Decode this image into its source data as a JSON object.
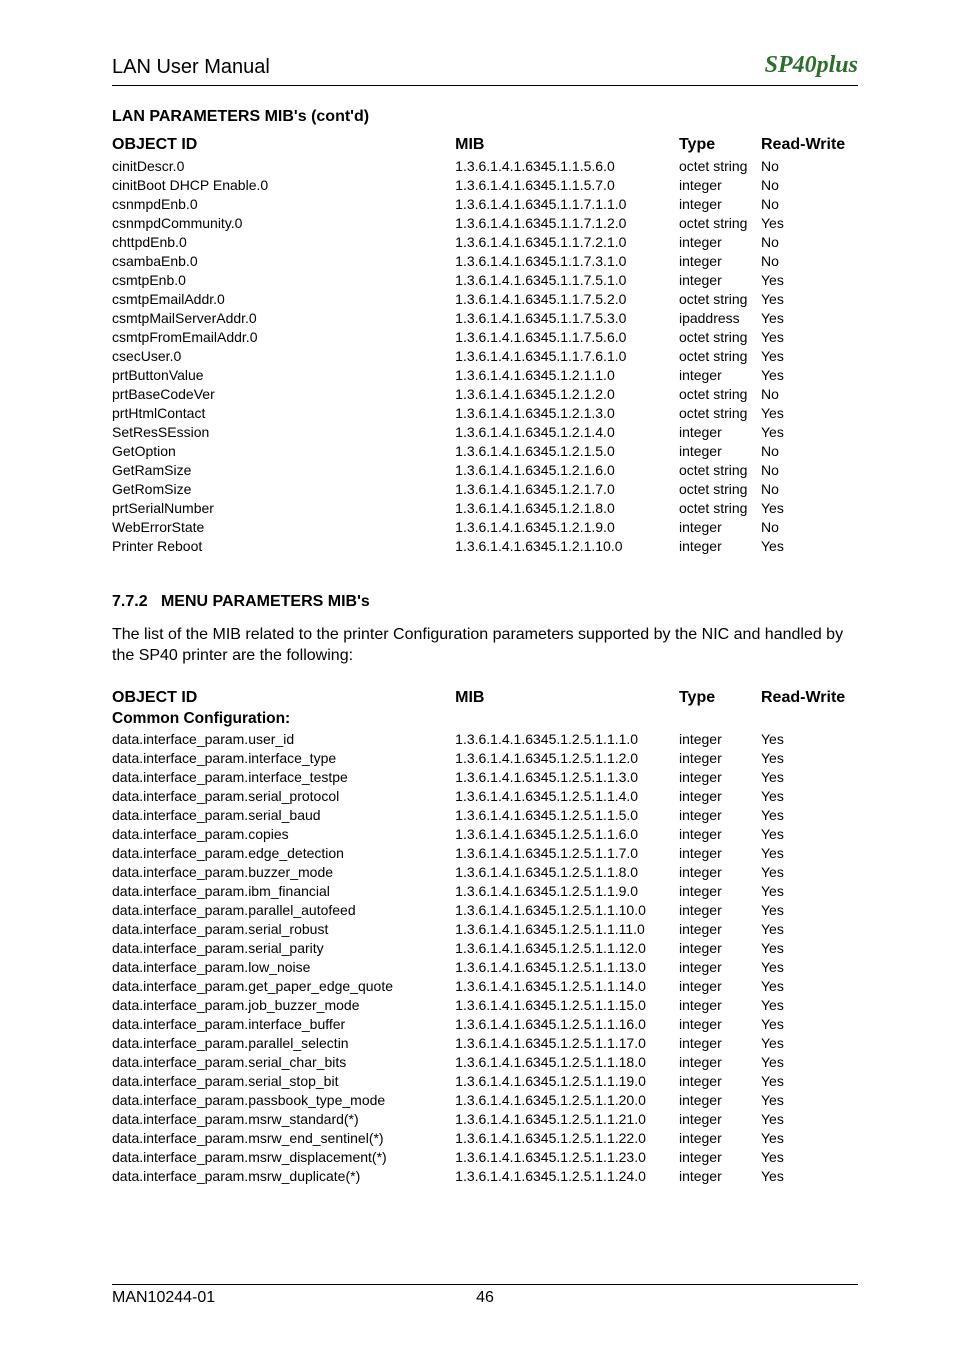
{
  "doc_title": "LAN User Manual",
  "brand_main": "SP40",
  "brand_sub": "plus",
  "section1_heading": "LAN PARAMETERS MIB's (cont'd)",
  "headers": {
    "object_id": "OBJECT ID",
    "mib": "MIB",
    "type": "Type",
    "rw": "Read-Write"
  },
  "table1": [
    {
      "obj": "cinitDescr.0",
      "mib": "1.3.6.1.4.1.6345.1.1.5.6.0",
      "type": "octet string",
      "rw": "No"
    },
    {
      "obj": "cinitBoot DHCP Enable.0",
      "mib": "1.3.6.1.4.1.6345.1.1.5.7.0",
      "type": "integer",
      "rw": "No"
    },
    {
      "obj": "csnmpdEnb.0",
      "mib": "1.3.6.1.4.1.6345.1.1.7.1.1.0",
      "type": "integer",
      "rw": "No"
    },
    {
      "obj": "csnmpdCommunity.0",
      "mib": "1.3.6.1.4.1.6345.1.1.7.1.2.0",
      "type": "octet string",
      "rw": "Yes"
    },
    {
      "obj": "chttpdEnb.0",
      "mib": "1.3.6.1.4.1.6345.1.1.7.2.1.0",
      "type": "integer",
      "rw": "No"
    },
    {
      "obj": "csambaEnb.0",
      "mib": "1.3.6.1.4.1.6345.1.1.7.3.1.0",
      "type": "integer",
      "rw": "No"
    },
    {
      "obj": "csmtpEnb.0",
      "mib": "1.3.6.1.4.1.6345.1.1.7.5.1.0",
      "type": "integer",
      "rw": "Yes"
    },
    {
      "obj": "csmtpEmailAddr.0",
      "mib": "1.3.6.1.4.1.6345.1.1.7.5.2.0",
      "type": "octet string",
      "rw": "Yes"
    },
    {
      "obj": "csmtpMailServerAddr.0",
      "mib": "1.3.6.1.4.1.6345.1.1.7.5.3.0",
      "type": "ipaddress",
      "rw": "Yes"
    },
    {
      "obj": "csmtpFromEmailAddr.0",
      "mib": "1.3.6.1.4.1.6345.1.1.7.5.6.0",
      "type": "octet string",
      "rw": "Yes"
    },
    {
      "obj": "csecUser.0",
      "mib": "1.3.6.1.4.1.6345.1.1.7.6.1.0",
      "type": "octet string",
      "rw": "Yes"
    },
    {
      "obj": "prtButtonValue",
      "mib": "1.3.6.1.4.1.6345.1.2.1.1.0",
      "type": "integer",
      "rw": "Yes"
    },
    {
      "obj": "prtBaseCodeVer",
      "mib": "1.3.6.1.4.1.6345.1.2.1.2.0",
      "type": "octet string",
      "rw": "No"
    },
    {
      "obj": "prtHtmlContact",
      "mib": "1.3.6.1.4.1.6345.1.2.1.3.0",
      "type": "octet string",
      "rw": "Yes"
    },
    {
      "obj": "SetResSEssion",
      "mib": "1.3.6.1.4.1.6345.1.2.1.4.0",
      "type": "integer",
      "rw": "Yes"
    },
    {
      "obj": "GetOption",
      "mib": "1.3.6.1.4.1.6345.1.2.1.5.0",
      "type": "integer",
      "rw": "No"
    },
    {
      "obj": "GetRamSize",
      "mib": "1.3.6.1.4.1.6345.1.2.1.6.0",
      "type": "octet string",
      "rw": "No"
    },
    {
      "obj": "GetRomSize",
      "mib": "1.3.6.1.4.1.6345.1.2.1.7.0",
      "type": "octet string",
      "rw": "No"
    },
    {
      "obj": "prtSerialNumber",
      "mib": "1.3.6.1.4.1.6345.1.2.1.8.0",
      "type": "octet string",
      "rw": "Yes"
    },
    {
      "obj": "WebErrorState",
      "mib": "1.3.6.1.4.1.6345.1.2.1.9.0",
      "type": "integer",
      "rw": "No"
    },
    {
      "obj": "Printer Reboot",
      "mib": "1.3.6.1.4.1.6345.1.2.1.10.0",
      "type": "integer",
      "rw": "Yes"
    }
  ],
  "section2_number": "7.7.2",
  "section2_title": "MENU PARAMETERS MIB's",
  "section2_text": "The list of the MIB related to the printer Configuration parameters supported by the NIC and handled by the SP40 printer are the following:",
  "common_config_label": "Common Configuration:",
  "table2": [
    {
      "obj": "data.interface_param.user_id",
      "mib": "1.3.6.1.4.1.6345.1.2.5.1.1.1.0",
      "type": "integer",
      "rw": "Yes"
    },
    {
      "obj": "data.interface_param.interface_type",
      "mib": "1.3.6.1.4.1.6345.1.2.5.1.1.2.0",
      "type": "integer",
      "rw": "Yes"
    },
    {
      "obj": "data.interface_param.interface_testpe",
      "mib": "1.3.6.1.4.1.6345.1.2.5.1.1.3.0",
      "type": "integer",
      "rw": "Yes"
    },
    {
      "obj": "data.interface_param.serial_protocol",
      "mib": "1.3.6.1.4.1.6345.1.2.5.1.1.4.0",
      "type": "integer",
      "rw": "Yes"
    },
    {
      "obj": "data.interface_param.serial_baud",
      "mib": "1.3.6.1.4.1.6345.1.2.5.1.1.5.0",
      "type": "integer",
      "rw": "Yes"
    },
    {
      "obj": "data.interface_param.copies",
      "mib": "1.3.6.1.4.1.6345.1.2.5.1.1.6.0",
      "type": "integer",
      "rw": "Yes"
    },
    {
      "obj": "data.interface_param.edge_detection",
      "mib": "1.3.6.1.4.1.6345.1.2.5.1.1.7.0",
      "type": "integer",
      "rw": "Yes"
    },
    {
      "obj": "data.interface_param.buzzer_mode",
      "mib": "1.3.6.1.4.1.6345.1.2.5.1.1.8.0",
      "type": "integer",
      "rw": "Yes"
    },
    {
      "obj": "data.interface_param.ibm_financial",
      "mib": "1.3.6.1.4.1.6345.1.2.5.1.1.9.0",
      "type": "integer",
      "rw": "Yes"
    },
    {
      "obj": "data.interface_param.parallel_autofeed",
      "mib": "1.3.6.1.4.1.6345.1.2.5.1.1.10.0",
      "type": "integer",
      "rw": "Yes"
    },
    {
      "obj": "data.interface_param.serial_robust",
      "mib": "1.3.6.1.4.1.6345.1.2.5.1.1.11.0",
      "type": "integer",
      "rw": "Yes"
    },
    {
      "obj": "data.interface_param.serial_parity",
      "mib": "1.3.6.1.4.1.6345.1.2.5.1.1.12.0",
      "type": "integer",
      "rw": "Yes"
    },
    {
      "obj": "data.interface_param.low_noise",
      "mib": "1.3.6.1.4.1.6345.1.2.5.1.1.13.0",
      "type": "integer",
      "rw": "Yes"
    },
    {
      "obj": "data.interface_param.get_paper_edge_quote",
      "mib": "1.3.6.1.4.1.6345.1.2.5.1.1.14.0",
      "type": "integer",
      "rw": "Yes"
    },
    {
      "obj": "data.interface_param.job_buzzer_mode",
      "mib": "1.3.6.1.4.1.6345.1.2.5.1.1.15.0",
      "type": "integer",
      "rw": "Yes"
    },
    {
      "obj": "data.interface_param.interface_buffer",
      "mib": "1.3.6.1.4.1.6345.1.2.5.1.1.16.0",
      "type": "integer",
      "rw": "Yes"
    },
    {
      "obj": "data.interface_param.parallel_selectin",
      "mib": "1.3.6.1.4.1.6345.1.2.5.1.1.17.0",
      "type": "integer",
      "rw": "Yes"
    },
    {
      "obj": "data.interface_param.serial_char_bits",
      "mib": "1.3.6.1.4.1.6345.1.2.5.1.1.18.0",
      "type": "integer",
      "rw": "Yes"
    },
    {
      "obj": "data.interface_param.serial_stop_bit",
      "mib": "1.3.6.1.4.1.6345.1.2.5.1.1.19.0",
      "type": "integer",
      "rw": "Yes"
    },
    {
      "obj": "data.interface_param.passbook_type_mode",
      "mib": "1.3.6.1.4.1.6345.1.2.5.1.1.20.0",
      "type": "integer",
      "rw": "Yes"
    },
    {
      "obj": "data.interface_param.msrw_standard(*)",
      "mib": "1.3.6.1.4.1.6345.1.2.5.1.1.21.0",
      "type": "integer",
      "rw": "Yes"
    },
    {
      "obj": "data.interface_param.msrw_end_sentinel(*)",
      "mib": "1.3.6.1.4.1.6345.1.2.5.1.1.22.0",
      "type": "integer",
      "rw": "Yes"
    },
    {
      "obj": "data.interface_param.msrw_displacement(*)",
      "mib": "1.3.6.1.4.1.6345.1.2.5.1.1.23.0",
      "type": "integer",
      "rw": "Yes"
    },
    {
      "obj": "data.interface_param.msrw_duplicate(*)",
      "mib": "1.3.6.1.4.1.6345.1.2.5.1.1.24.0",
      "type": "integer",
      "rw": "Yes"
    }
  ],
  "footer_left": "MAN10244-01",
  "footer_center": "46"
}
